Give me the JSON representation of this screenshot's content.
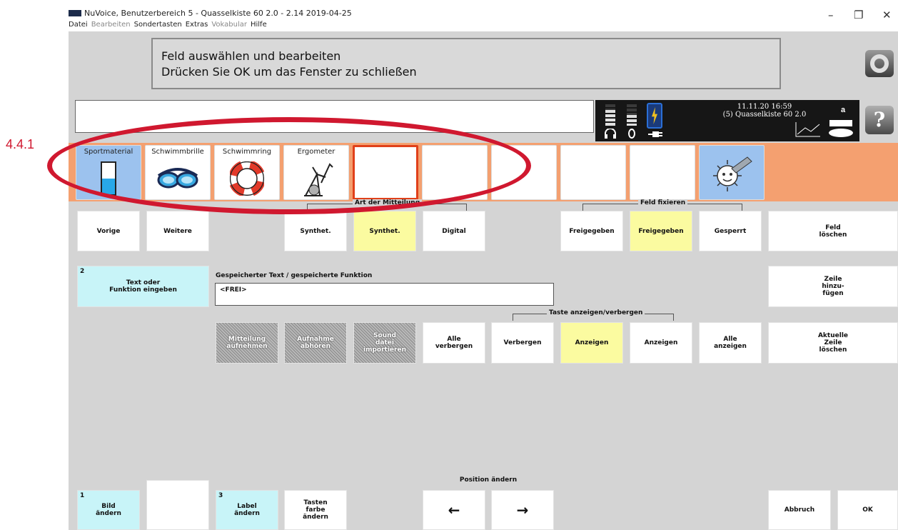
{
  "window": {
    "title": "NuVoice, Benutzerbereich 5 - Quasselkiste 60 2.0 - 2.14 2019-04-25",
    "minimize_label": "–",
    "maximize_label": "❐",
    "close_label": "✕"
  },
  "menu": [
    "Datei",
    "Bearbeiten",
    "Sondertasten",
    "Extras",
    "Vokabular",
    "Hilfe"
  ],
  "info": {
    "line1": "Feld auswählen und bearbeiten",
    "line2": "Drücken Sie OK um das Fenster zu schließen"
  },
  "status": {
    "date": "11.11.20 16:59",
    "vocab": "(5) Quasselkiste 60 2.0",
    "indicator": "a",
    "volume_level": 0.75,
    "mic_level": 0.5
  },
  "help_label": "?",
  "vocab_keys": [
    {
      "label": "Sportmaterial",
      "icon": "glass-icon"
    },
    {
      "label": "Schwimmbrille",
      "icon": "goggles-icon"
    },
    {
      "label": "Schwimmring",
      "icon": "lifebuoy-icon"
    },
    {
      "label": "Ergometer",
      "icon": "exercise-bike-icon"
    },
    {
      "label": "",
      "icon": ""
    },
    {
      "label": "",
      "icon": ""
    },
    {
      "label": "",
      "icon": ""
    },
    {
      "label": "",
      "icon": ""
    },
    {
      "label": "",
      "icon": ""
    },
    {
      "label": "",
      "icon": "sun-pencil-icon"
    }
  ],
  "groups": {
    "art": "Art der Mitteilung",
    "feld": "Feld fixieren",
    "taste": "Taste anzeigen/verbergen"
  },
  "buttons": {
    "vorige": "Vorige",
    "weitere": "Weitere",
    "synth1": "Synthet.",
    "synth2": "Synthet.",
    "digital": "Digital",
    "freigegeben1": "Freigegeben",
    "freigegeben2": "Freigegeben",
    "gesperrt": "Gesperrt",
    "feld_loeschen": "Feld\nlöschen",
    "text_eingeben": "Text oder\nFunktion eingeben",
    "text_num": "2",
    "zeile_hinzu": "Zeile\nhinzu-\nfügen",
    "mitteilung": "Mitteilung\naufnehmen",
    "aufnahme": "Aufnahme\nabhören",
    "sound": "Sound\ndatei\nimportieren",
    "alle_verbergen": "Alle\nverbergen",
    "verbergen": "Verbergen",
    "anzeigen1": "Anzeigen",
    "anzeigen2": "Anzeigen",
    "alle_anzeigen": "Alle\nanzeigen",
    "aktuelle_zeile": "Aktuelle\nZeile\nlöschen",
    "bild": "Bild\nändern",
    "bild_num": "1",
    "label": "Label\nändern",
    "label_num": "3",
    "tasten_farbe": "Tasten\nfarbe\nändern",
    "left_arrow": "←",
    "right_arrow": "→",
    "abbruch": "Abbruch",
    "ok": "OK"
  },
  "func": {
    "label": "Gespeicherter Text / gespeicherte Funktion",
    "value": "<FREI>"
  },
  "position_label": "Position ändern",
  "annotation": "4.4.1"
}
